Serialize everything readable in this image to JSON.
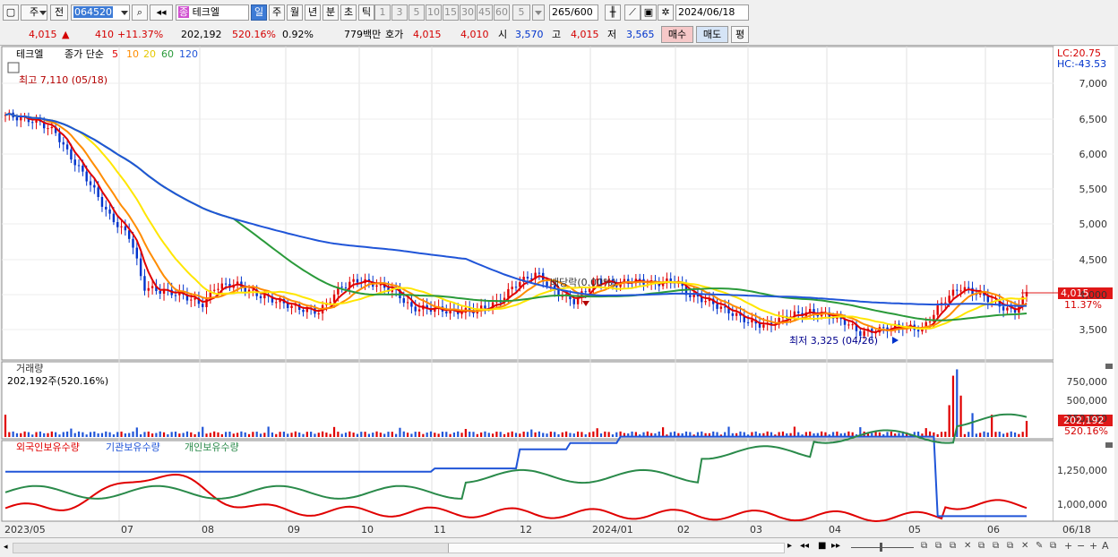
{
  "toolbar": {
    "market_label": "주",
    "prev_label": "전",
    "code_value": "064520",
    "name_label": "테크엘",
    "name_badge": "종",
    "periods": [
      "일",
      "주",
      "월",
      "년",
      "분",
      "초",
      "틱"
    ],
    "active_period": "일",
    "intervals": [
      "1",
      "3",
      "5",
      "10",
      "15",
      "30",
      "45",
      "60"
    ],
    "count_value": "5",
    "range_value": "265",
    "range_total": "/600",
    "date_value": "2024/06/18"
  },
  "quote": {
    "price": "4,015",
    "change_arrow": "▲",
    "change": "410",
    "change_pct": "+11.37%",
    "volume": "202,192",
    "volume_ratio": "520.16%",
    "turnover": "0.92%",
    "amount": "779백만",
    "hoga_label": "호가",
    "ask": "4,015",
    "bid": "4,010",
    "open_label": "시",
    "open": "3,570",
    "high_label": "고",
    "high": "4,015",
    "low_label": "저",
    "low": "3,565",
    "buy_label": "매수",
    "sell_label": "매도",
    "eval_label": "평"
  },
  "price_panel": {
    "stock_name": "테크엘",
    "ma_title": "종가 단순",
    "ma_periods": [
      "5",
      "10",
      "20",
      "60",
      "120"
    ],
    "ma_colors": [
      "#e00000",
      "#ff8c00",
      "#ffe600",
      "#2a9a3a",
      "#2055d8"
    ],
    "high_annotation": "최고 7,110 (05/18)",
    "low_annotation": "최저 3,325 (04/26)",
    "dividend_annotation": "배당락(0.00%)",
    "lc_label": "LC:20.75",
    "hc_label": "HC:-43.53",
    "current_price_tag": "4,015",
    "current_pct_tag": "11.37%",
    "y_ticks": [
      "7,000",
      "6,500",
      "6,000",
      "5,500",
      "5,000",
      "4,500",
      "4,000",
      "3,500"
    ]
  },
  "volume_panel": {
    "title": "거래량",
    "subtitle": "202,192주(520.16%)",
    "y_ticks": [
      "750,000",
      "500,000",
      "250,000"
    ],
    "value_tag": "202,192",
    "pct_tag": "520.16%"
  },
  "holdings_panel": {
    "series_labels": [
      "외국인보유수량",
      "기관보유수량",
      "개인보유수량"
    ],
    "series_colors": [
      "#e00000",
      "#2055d8",
      "#2a8a4a"
    ],
    "y_ticks": [
      "1,250,000",
      "1,000,000"
    ]
  },
  "x_axis": {
    "labels": [
      "2023/05",
      "07",
      "08",
      "09",
      "10",
      "11",
      "12",
      "2024/01",
      "02",
      "03",
      "04",
      "05",
      "06",
      "06/18"
    ]
  },
  "colors": {
    "up": "#d40000",
    "down": "#0033cc",
    "active": "#3d7bd6"
  }
}
